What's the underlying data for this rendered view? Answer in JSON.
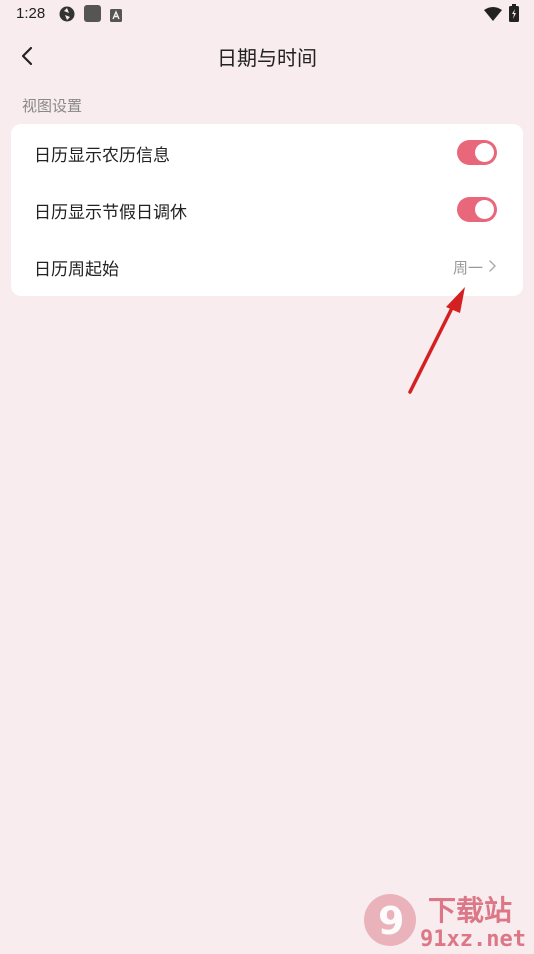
{
  "status_bar": {
    "time": "1:28",
    "icons": [
      "settings-sync-icon",
      "app-square-icon",
      "keyboard-a-icon",
      "wifi-icon",
      "battery-charging-icon"
    ]
  },
  "header": {
    "back_icon": "chevron-left-icon",
    "title": "日期与时间"
  },
  "section": {
    "label": "视图设置"
  },
  "settings": [
    {
      "label": "日历显示农历信息",
      "control": "toggle",
      "on": true
    },
    {
      "label": "日历显示节假日调休",
      "control": "toggle",
      "on": true
    },
    {
      "label": "日历周起始",
      "control": "select",
      "value": "周一"
    }
  ],
  "colors": {
    "background": "#f8ecee",
    "card": "#ffffff",
    "accent": "#e8677b",
    "annotation_arrow": "#d42020"
  },
  "watermark": {
    "logo_text": "9",
    "text_top": "下载站",
    "text_bottom": "91xz.net"
  }
}
